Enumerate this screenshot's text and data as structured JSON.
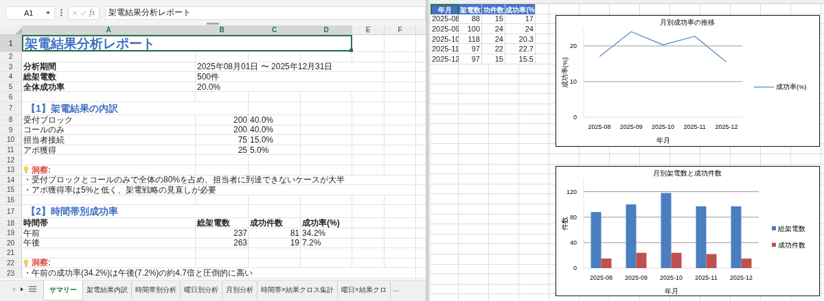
{
  "left_window": {
    "formula_bar": {
      "cell_ref": "A1",
      "fx": "fx",
      "formula": "架電結果分析レポート"
    },
    "columns": [
      {
        "label": "A",
        "selected": true
      },
      {
        "label": "B",
        "selected": true
      },
      {
        "label": "C",
        "selected": true
      },
      {
        "label": "D",
        "selected": true
      },
      {
        "label": "E",
        "selected": false
      },
      {
        "label": "F",
        "selected": false
      }
    ],
    "rows": [
      {
        "number": "1",
        "selected": true,
        "kind": "title",
        "cells": [
          "架電結果分析レポート"
        ]
      },
      {
        "number": "2",
        "selected": false,
        "kind": "blank"
      },
      {
        "number": "3",
        "selected": false,
        "kind": "field",
        "cells": [
          "分析期間",
          "2025年08月01日 〜 2025年12月31日"
        ]
      },
      {
        "number": "4",
        "selected": false,
        "kind": "field",
        "cells": [
          "総架電数",
          "500件"
        ]
      },
      {
        "number": "5",
        "selected": false,
        "kind": "field",
        "cells": [
          "全体成功率",
          "20.0%"
        ]
      },
      {
        "number": "6",
        "selected": false,
        "kind": "blank"
      },
      {
        "number": "7",
        "selected": false,
        "kind": "section",
        "cells": [
          "【1】架電結果の内訳"
        ]
      },
      {
        "number": "8",
        "selected": false,
        "kind": "breakdown",
        "cells": [
          "受付ブロック",
          "200",
          "40.0%"
        ]
      },
      {
        "number": "9",
        "selected": false,
        "kind": "breakdown",
        "cells": [
          "コールのみ",
          "200",
          "40.0%"
        ]
      },
      {
        "number": "10",
        "selected": false,
        "kind": "breakdown",
        "cells": [
          "担当者接続",
          "75",
          "15.0%"
        ]
      },
      {
        "number": "11",
        "selected": false,
        "kind": "breakdown",
        "cells": [
          "アポ獲得",
          "25",
          "5.0%"
        ]
      },
      {
        "number": "12",
        "selected": false,
        "kind": "blank"
      },
      {
        "number": "13",
        "selected": false,
        "kind": "insight",
        "cells": [
          "洞察:"
        ]
      },
      {
        "number": "14",
        "selected": false,
        "kind": "note",
        "cells": [
          "・受付ブロックとコールのみで全体の80%を占め、担当者に到達できないケースが大半"
        ]
      },
      {
        "number": "15",
        "selected": false,
        "kind": "note",
        "cells": [
          "・アポ獲得率は5%と低く、架電戦略の見直しが必要"
        ]
      },
      {
        "number": "16",
        "selected": false,
        "kind": "blank"
      },
      {
        "number": "17",
        "selected": false,
        "kind": "section",
        "cells": [
          "【2】時間帯別成功率"
        ]
      },
      {
        "number": "18",
        "selected": false,
        "kind": "header",
        "cells": [
          "時間帯",
          "総架電数",
          "成功件数",
          "成功率(%)"
        ]
      },
      {
        "number": "19",
        "selected": false,
        "kind": "data",
        "cells": [
          "午前",
          "237",
          "81",
          "34.2%"
        ]
      },
      {
        "number": "20",
        "selected": false,
        "kind": "data",
        "cells": [
          "午後",
          "263",
          "19",
          "7.2%"
        ]
      },
      {
        "number": "21",
        "selected": false,
        "kind": "blank"
      },
      {
        "number": "22",
        "selected": false,
        "kind": "insight",
        "cells": [
          "洞察:"
        ]
      },
      {
        "number": "23",
        "selected": false,
        "kind": "note",
        "cells": [
          "・午前の成功率(34.2%)は午後(7.2%)の約4.7倍と圧倒的に高い"
        ]
      }
    ],
    "sheet_tabs": [
      {
        "label": "サマリー",
        "selected": true
      },
      {
        "label": "架電結果内訳",
        "selected": false
      },
      {
        "label": "時間帯別分析",
        "selected": false
      },
      {
        "label": "曜日別分析",
        "selected": false
      },
      {
        "label": "月別分析",
        "selected": false
      },
      {
        "label": "時間帯×結果クロス集計",
        "selected": false
      },
      {
        "label": "曜日×結果クロ",
        "selected": false
      }
    ],
    "more_tabs": "…"
  },
  "right_window": {
    "table": {
      "columns": [
        {
          "label": "年月",
          "selected": true
        },
        {
          "label": "架電数",
          "selected": false
        },
        {
          "label": "功件数",
          "selected": false
        },
        {
          "label": "成功率(%",
          "selected": false
        }
      ],
      "rows": [
        [
          "2025-08",
          "88",
          "15",
          "17"
        ],
        [
          "2025-09",
          "100",
          "24",
          "24"
        ],
        [
          "2025-10",
          "118",
          "24",
          "20.3"
        ],
        [
          "2025-11",
          "97",
          "22",
          "22.7"
        ],
        [
          "2025-12",
          "97",
          "15",
          "15.5"
        ]
      ]
    },
    "charts": [
      {
        "chart_data": {
          "type": "line",
          "title": "月別成功率の推移",
          "xlabel": "年月",
          "ylabel": "成功率(%)",
          "categories": [
            "2025-08",
            "2025-09",
            "2025-10",
            "2025-11",
            "2025-12"
          ],
          "ylim": [
            0,
            25
          ],
          "yticks": [
            0,
            10,
            20
          ],
          "grid": true,
          "legend": true,
          "series": [
            {
              "name": "成功率(%)",
              "color": "#5b8cc8",
              "values": [
                17,
                24,
                20.3,
                22.7,
                15.5
              ]
            }
          ]
        }
      },
      {
        "chart_data": {
          "type": "bar",
          "title": "月別架電数と成功件数",
          "xlabel": "年月",
          "ylabel": "件数",
          "categories": [
            "2025-08",
            "2025-09",
            "2025-10",
            "2025-11",
            "2025-12"
          ],
          "ylim": [
            0,
            140
          ],
          "yticks": [
            0,
            40,
            80,
            120
          ],
          "grid": true,
          "legend": true,
          "series": [
            {
              "name": "総架電数",
              "color": "#4a7ebf",
              "values": [
                88,
                100,
                118,
                97,
                97
              ]
            },
            {
              "name": "成功件数",
              "color": "#c0504d",
              "values": [
                15,
                24,
                24,
                22,
                15
              ]
            }
          ]
        }
      }
    ]
  }
}
